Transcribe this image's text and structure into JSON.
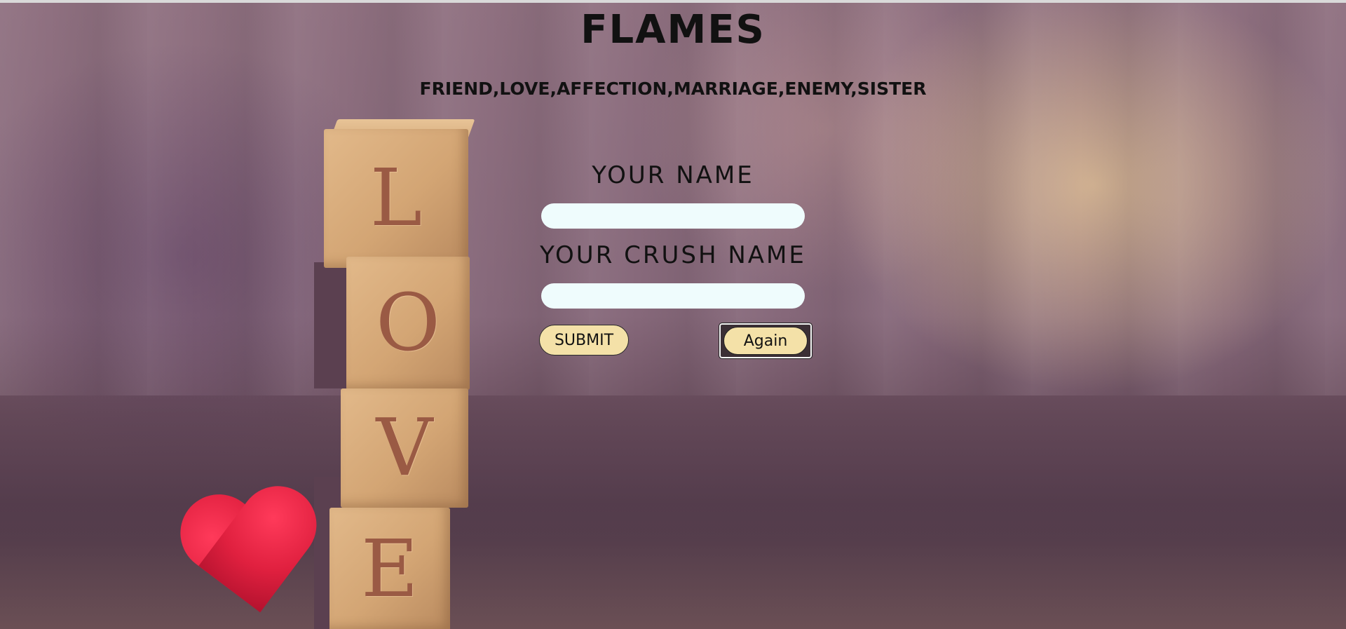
{
  "app": {
    "title": "FLAMES",
    "subtitle": "FRIEND,LOVE,AFFECTION,MARRIAGE,ENEMY,SISTER"
  },
  "form": {
    "name_label": "YOUR NAME",
    "name_value": "",
    "crush_label": "YOUR CRUSH NAME",
    "crush_value": "",
    "submit_label": "SUBMIT",
    "again_label": "Again"
  },
  "background": {
    "blocks": [
      "L",
      "O",
      "V",
      "E"
    ],
    "heart_color": "#e0203f"
  },
  "colors": {
    "button_fill": "#f4e1a8",
    "input_fill": "#effcfd",
    "text": "#111111"
  }
}
